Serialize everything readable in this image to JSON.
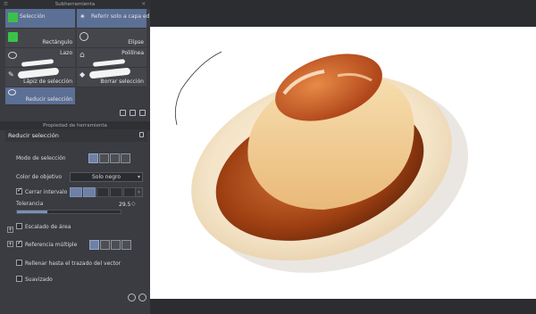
{
  "subtool_panel": {
    "title": "Subherramienta",
    "tools": [
      {
        "label": "Selección",
        "swatch": "#3bc14a"
      },
      {
        "label": "Referir solo a capa ed"
      },
      {
        "label": "Rectángulo",
        "swatch": "#3bc14a"
      },
      {
        "label": "Elipse"
      },
      {
        "label": "Lazo"
      },
      {
        "label": "Polilínea"
      },
      {
        "label": "Lápiz de selección"
      },
      {
        "label": "Borrar selección"
      },
      {
        "label": "Reducir selección"
      }
    ]
  },
  "tool_property": {
    "title": "Propiedad de herramienta",
    "tool_name": "Reducir selección",
    "selection_mode_label": "Modo de selección",
    "target_color_label": "Color de objetivo",
    "target_color_value": "Solo negro",
    "close_gap_label": "Cerrar intervalo",
    "tolerance_label": "Tolerancia",
    "tolerance_value": "29.5",
    "tolerance_fraction": 0.295,
    "area_scaling_label": "Escalado de área",
    "multi_ref_label": "Referencia múltiple",
    "fill_vector_label": "Rellenar hasta el trazado del vector",
    "smoothing_label": "Suavizado"
  },
  "colors": {
    "panel_bg": "#3a3c41",
    "selected": "#5c6f95",
    "accent": "#7a8fb8"
  }
}
